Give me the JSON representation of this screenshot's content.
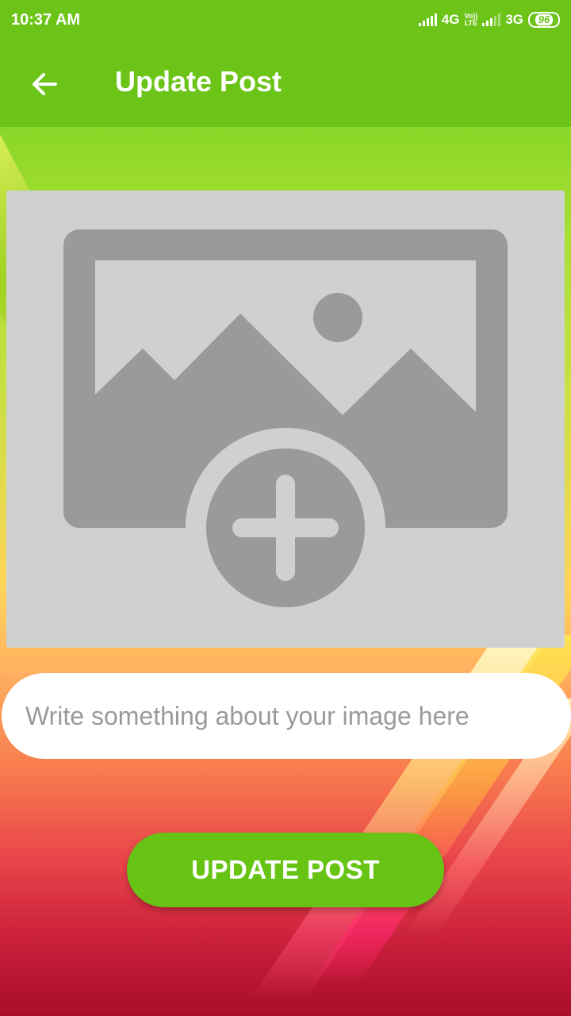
{
  "status_bar": {
    "time": "10:37 AM",
    "network_1": "4G",
    "volte_top": "Vo))",
    "volte_bottom": "LTE",
    "network_2": "3G",
    "battery": "96"
  },
  "app_bar": {
    "title": "Update Post",
    "back_icon": "arrow-left-icon"
  },
  "image_picker": {
    "icon": "add-photo-icon"
  },
  "caption": {
    "placeholder": "Write something about your image here",
    "value": ""
  },
  "actions": {
    "update_label": "UPDATE POST"
  },
  "colors": {
    "primary": "#6cc418",
    "button": "#67c415",
    "placeholder_box": "#cfd0d0",
    "icon_gray": "#9a9a9a"
  }
}
